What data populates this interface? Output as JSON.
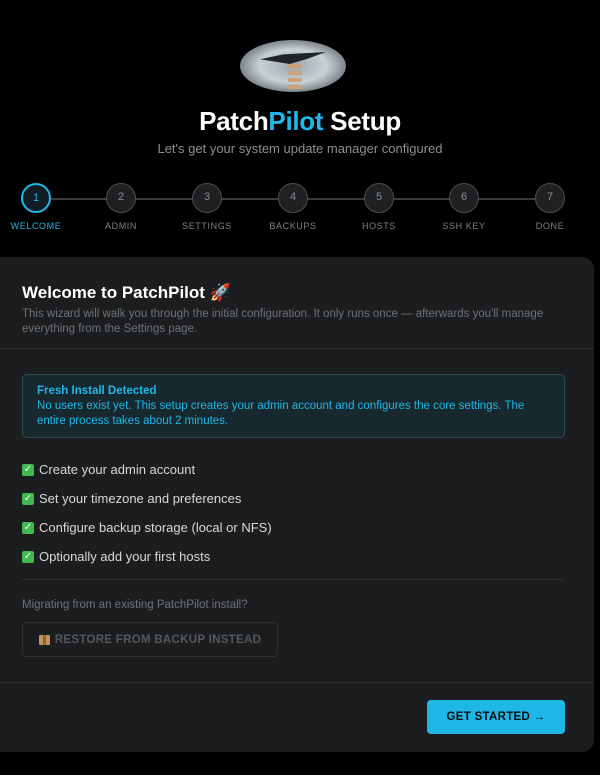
{
  "header": {
    "title_part1": "Patch",
    "title_accent": "Pilot",
    "title_part3": " Setup",
    "subtitle": "Let's get your system update manager configured"
  },
  "stepper": {
    "active_index": 0,
    "steps": [
      {
        "number": "1",
        "label": "WELCOME"
      },
      {
        "number": "2",
        "label": "ADMIN"
      },
      {
        "number": "3",
        "label": "SETTINGS"
      },
      {
        "number": "4",
        "label": "BACKUPS"
      },
      {
        "number": "5",
        "label": "HOSTS"
      },
      {
        "number": "6",
        "label": "SSH KEY"
      },
      {
        "number": "7",
        "label": "DONE"
      }
    ]
  },
  "welcome": {
    "heading": "Welcome to PatchPilot 🚀",
    "intro": "This wizard will walk you through the initial configuration. It only runs once — afterwards you'll manage everything from the Settings page."
  },
  "alert": {
    "title": "Fresh Install Detected",
    "body": "No users exist yet. This setup creates your admin account and configures the core settings. The entire process takes about 2 minutes."
  },
  "checklist": [
    {
      "icon": "check-mark-icon",
      "text": "Create your admin account"
    },
    {
      "icon": "check-mark-icon",
      "text": "Set your timezone and preferences"
    },
    {
      "icon": "check-mark-icon",
      "text": "Configure backup storage (local or NFS)"
    },
    {
      "icon": "check-mark-icon",
      "text": "Optionally add your first hosts"
    }
  ],
  "migrate": {
    "prompt": "Migrating from an existing PatchPilot install?",
    "restore_label": "RESTORE FROM BACKUP INSTEAD",
    "restore_icon": "package-icon"
  },
  "actions": {
    "get_started_label": "GET STARTED →"
  },
  "colors": {
    "accent": "#1fb6e8",
    "background": "#000000",
    "card": "#1c1d1f",
    "check": "#3fb950"
  }
}
